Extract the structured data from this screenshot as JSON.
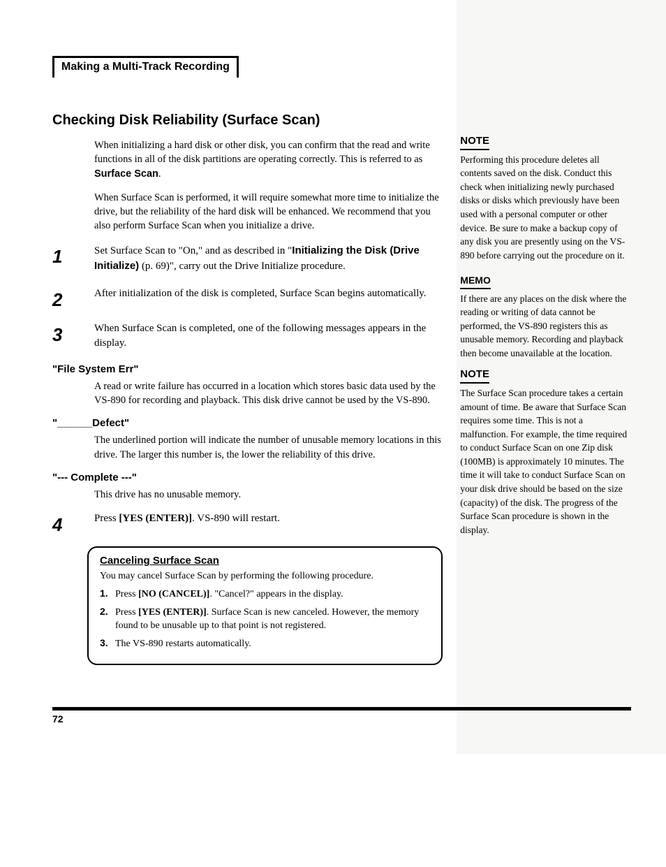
{
  "breadcrumb": "Making a Multi-Track Recording",
  "section_title": "Checking Disk Reliability (Surface Scan)",
  "intro1_a": "When initializing a hard disk or other disk, you can confirm that the read and write functions in all of the disk partitions are operating correctly. This is referred to as ",
  "intro1_b": "Surface Scan",
  "intro1_c": ".",
  "intro2": "When Surface Scan is performed, it will require somewhat more time to initialize the drive, but the reliability of the hard disk will be enhanced. We recommend that you also perform Surface Scan when you initialize a drive.",
  "steps": {
    "s1": {
      "num": "1",
      "a": "Set Surface Scan to \"On,\" and as described in \"",
      "b": "Initializing the Disk (Drive Initialize)",
      "c": " (p. 69)\", carry out the Drive Initialize procedure."
    },
    "s2": {
      "num": "2",
      "text": "After initialization of the disk is completed, Surface Scan begins automatically."
    },
    "s3": {
      "num": "3",
      "text": "When Surface Scan is completed, one of the following messages appears in the display."
    },
    "s4": {
      "num": "4",
      "a": "Press ",
      "b": "[YES (ENTER)]",
      "c": ". VS-890 will restart."
    }
  },
  "msg1_h": "\"File System Err\"",
  "msg1_b": "A read or write failure has occurred in a location which stores basic data used by the VS-890 for recording and playback. This disk drive cannot be used by the VS-890.",
  "msg2_h": "\"______Defect\"",
  "msg2_b": "The underlined portion will indicate the number of unusable memory locations in this drive. The larger this number is, the lower the reliability of this drive.",
  "msg3_h": "\"--- Complete ---\"",
  "msg3_b": "This drive has no unusable memory.",
  "cancel": {
    "title": "Canceling Surface Scan",
    "intro": "You may cancel Surface Scan by performing the following procedure.",
    "i1": {
      "num": "1.",
      "a": "Press ",
      "b": "[NO (CANCEL)]",
      "c": ". \"Cancel?\" appears in the display."
    },
    "i2": {
      "num": "2.",
      "a": "Press ",
      "b": "[YES (ENTER)]",
      "c": ". Surface Scan is new canceled. However, the memory found to be unusable up to that point is not registered."
    },
    "i3": {
      "num": "3.",
      "text": "The VS-890 restarts automatically."
    }
  },
  "side": {
    "note_label": "NOTE",
    "memo_label": "MEMO",
    "note1": "Performing this procedure deletes all contents saved on the disk. Conduct this check when initializing newly purchased disks or disks which previously have been used with a personal computer or other device. Be sure to make a backup copy of any disk you are presently using on the VS-890 before carrying out the procedure on it.",
    "memo1": "If there are any places on the disk where the reading or writing of data cannot be performed, the VS-890 registers this as unusable memory. Recording and playback then become unavailable at the location.",
    "note2": "The Surface Scan procedure takes a certain amount of time. Be aware that Surface Scan requires some time. This is not a malfunction. For example, the time required to conduct Surface Scan on one Zip disk (100MB) is approximately 10 minutes. The time it will take to conduct Surface Scan on your disk drive should be based on the size (capacity) of the disk. The progress of the Surface Scan procedure is shown in the display."
  },
  "page_num": "72"
}
